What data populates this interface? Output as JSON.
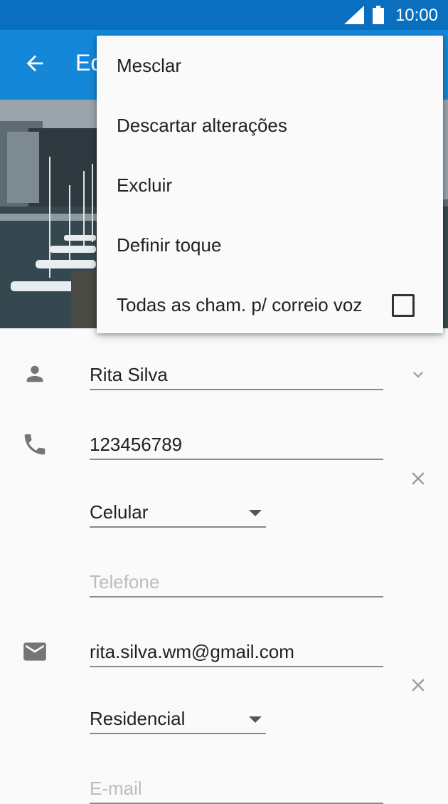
{
  "status_bar": {
    "time": "10:00"
  },
  "app_bar": {
    "title_fragment": "Ec"
  },
  "menu": {
    "items": [
      {
        "label": "Mesclar"
      },
      {
        "label": "Descartar alterações"
      },
      {
        "label": "Excluir"
      },
      {
        "label": "Definir toque"
      },
      {
        "label": "Todas as cham. p/ correio voz",
        "checked": false
      }
    ]
  },
  "form": {
    "name": "Rita Silva",
    "phone": "123456789",
    "phone_type": "Celular",
    "phone_placeholder": "Telefone",
    "email": "rita.silva.wm@gmail.com",
    "email_type": "Residencial",
    "email_placeholder": "E-mail"
  },
  "colors": {
    "status_bar": "#0a6fbf",
    "app_bar": "#1587d8",
    "background": "#fafafa",
    "icon": "#757575"
  }
}
